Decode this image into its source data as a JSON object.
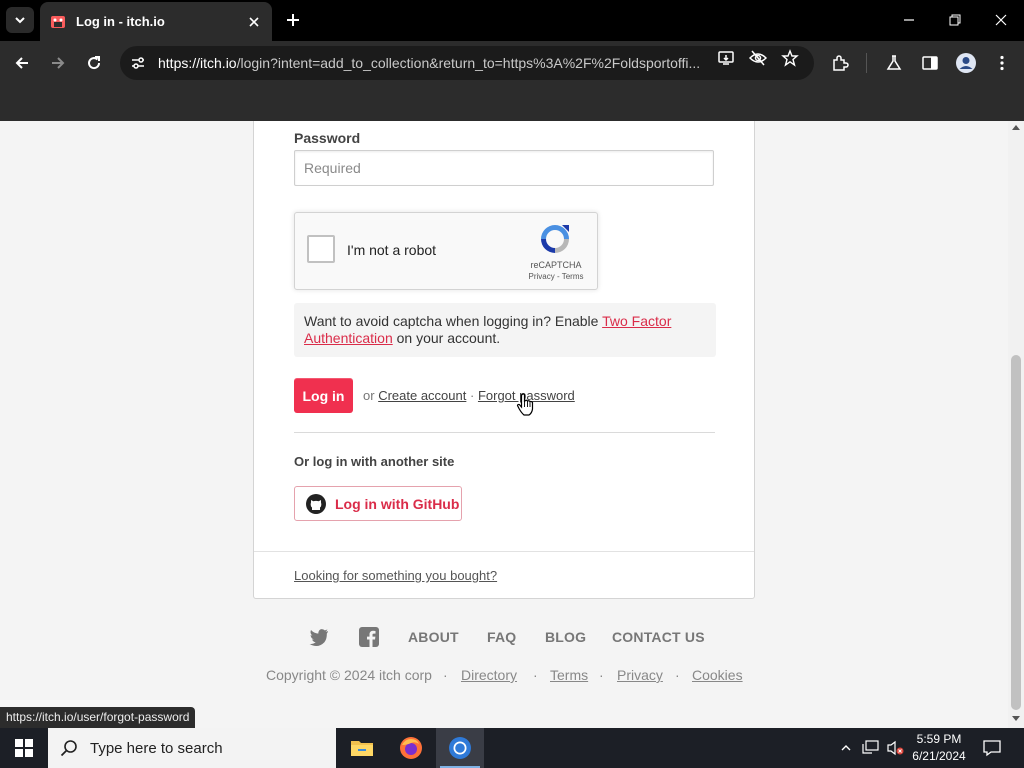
{
  "browser": {
    "tab_title": "Log in - itch.io",
    "url_host": "https://itch.io",
    "url_path": "/login?intent=add_to_collection&return_to=https%3A%2F%2Foldsportoffi...",
    "status_url": "https://itch.io/user/forgot-password"
  },
  "form": {
    "password_label": "Password",
    "password_placeholder": "Required",
    "recaptcha_label": "I'm not a robot",
    "recaptcha_brand": "reCAPTCHA",
    "recaptcha_privacy": "Privacy",
    "recaptcha_terms": "Terms",
    "twofa_text_before": "Want to avoid captcha when logging in? Enable ",
    "twofa_link": "Two Factor Authentication",
    "twofa_text_after": " on your account.",
    "login_button": "Log in",
    "or_text": "or",
    "create_account": "Create account",
    "dot": "·",
    "forgot_password": "Forgot password",
    "other_site_heading": "Or log in with another site",
    "github_button": "Log in with GitHub",
    "bought_link": "Looking for something you bought?"
  },
  "footer": {
    "links": [
      "ABOUT",
      "FAQ",
      "BLOG",
      "CONTACT US"
    ],
    "copyright": "Copyright © 2024 itch corp",
    "bottom_links": [
      "Directory",
      "Terms",
      "Privacy",
      "Cookies"
    ],
    "separator": "·"
  },
  "taskbar": {
    "search_placeholder": "Type here to search",
    "time": "5:59 PM",
    "date": "6/21/2024"
  },
  "colors": {
    "accent": "#f0304f",
    "link_red": "#da2c49"
  }
}
